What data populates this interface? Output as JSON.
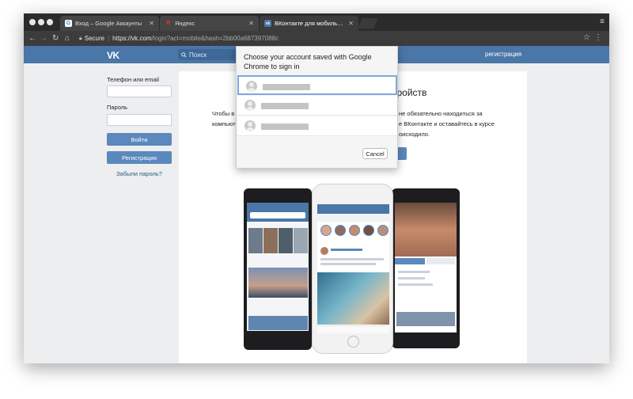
{
  "browser": {
    "tabs": [
      {
        "title": "Вход – Google Аккаунты",
        "favicon": "G"
      },
      {
        "title": "Яндекс",
        "favicon": "Я"
      },
      {
        "title": "ВКонтакте для мобильных уст",
        "favicon": "vk"
      }
    ],
    "security_label": "Secure",
    "url_host": "https://vk.com",
    "url_rest": "/login?act=mobile&hash=2bb00a687397088c"
  },
  "vk": {
    "logo": "VK",
    "search_placeholder": "Поиск",
    "register_link": "регистрация"
  },
  "login": {
    "phone_label": "Телефон или email",
    "password_label": "Пароль",
    "login_button": "Войти",
    "register_button": "Регистрация",
    "forgot_link": "Забыли пароль?"
  },
  "main": {
    "heading": "стройств",
    "desc_left": [
      "Чтобы в",
      "компьюте"
    ],
    "desc_right": [
      "не обязательно находиться за",
      "е ВКонтакте и оставайтесь в курсе",
      "оисходило."
    ]
  },
  "dialog": {
    "title": "Choose your account saved with Google Chrome to sign in",
    "cancel": "Cancel",
    "accounts": [
      "",
      "",
      ""
    ]
  },
  "colors": {
    "vk_blue": "#4a76a8",
    "button_blue": "#5b88bd",
    "link": "#2a5885"
  }
}
